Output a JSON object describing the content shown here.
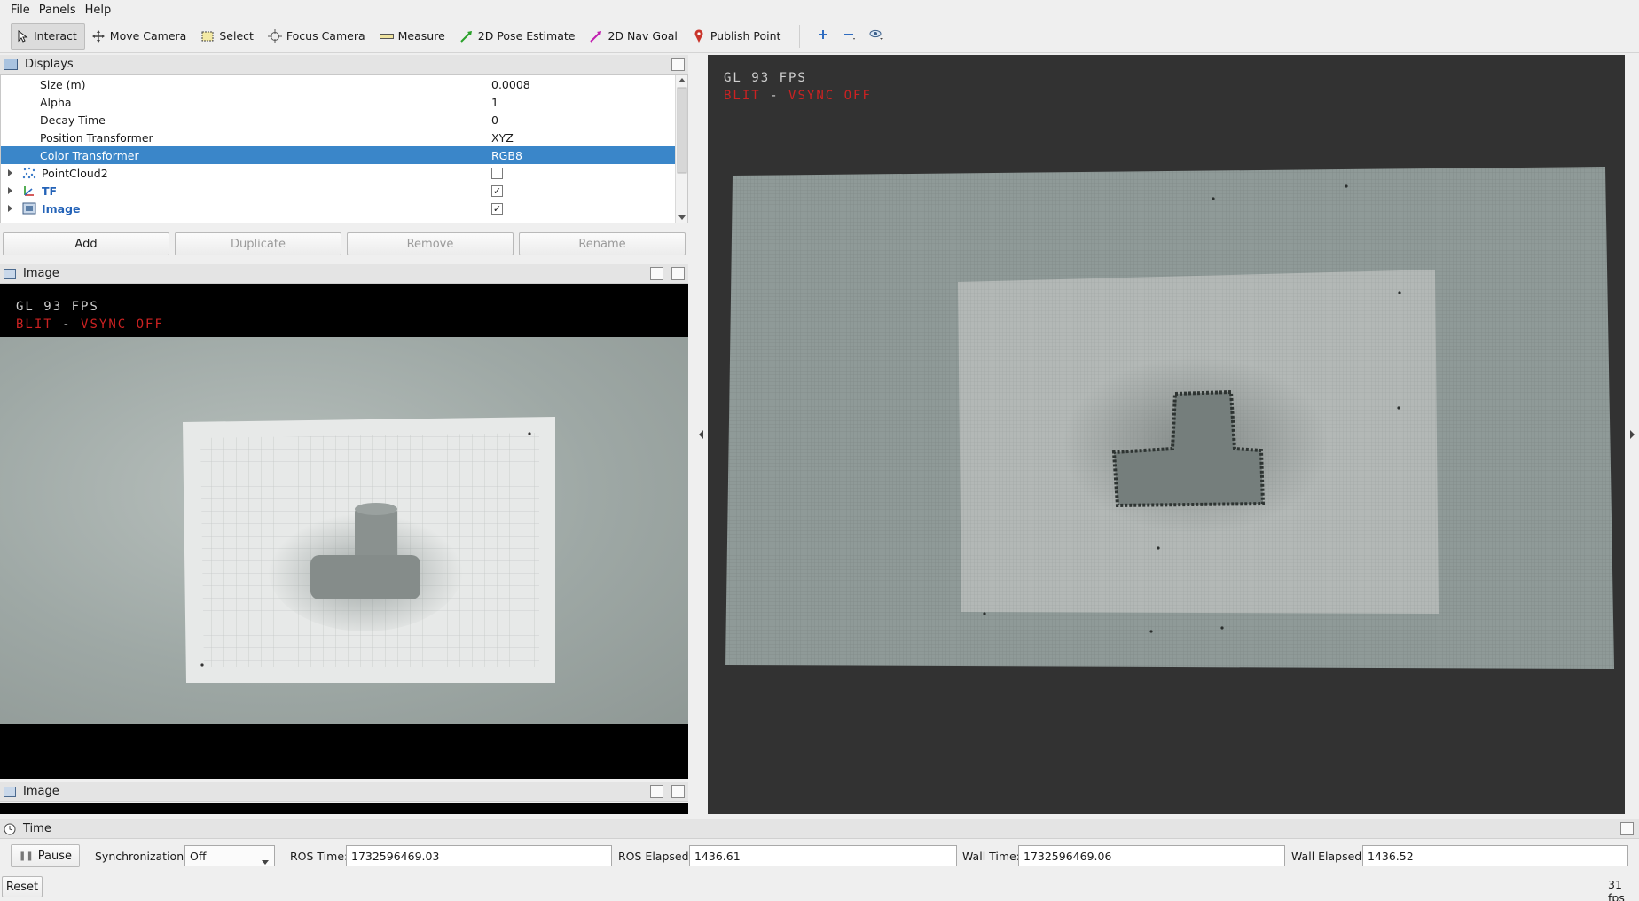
{
  "menu": {
    "file": "File",
    "panels": "Panels",
    "help": "Help"
  },
  "toolbar": {
    "interact": "Interact",
    "move_camera": "Move Camera",
    "select": "Select",
    "focus_camera": "Focus Camera",
    "measure": "Measure",
    "pose_estimate": "2D Pose Estimate",
    "nav_goal": "2D Nav Goal",
    "publish_point": "Publish Point"
  },
  "displays": {
    "title": "Displays",
    "props": [
      {
        "key": "Size (m)",
        "value": "0.0008"
      },
      {
        "key": "Alpha",
        "value": "1"
      },
      {
        "key": "Decay Time",
        "value": "0"
      },
      {
        "key": "Position Transformer",
        "value": "XYZ"
      },
      {
        "key": "Color Transformer",
        "value": "RGB8"
      }
    ],
    "items": [
      {
        "label": "PointCloud2",
        "checked": false
      },
      {
        "label": "TF",
        "checked": true
      },
      {
        "label": "Image",
        "checked": true
      }
    ],
    "buttons": {
      "add": "Add",
      "duplicate": "Duplicate",
      "remove": "Remove",
      "rename": "Rename"
    }
  },
  "image_panel_1": {
    "title": "Image"
  },
  "image_panel_2": {
    "title": "Image"
  },
  "overlay": {
    "fps": "GL 93 FPS",
    "blit": "BLIT",
    "dash": "-",
    "vsync": "VSYNC OFF"
  },
  "time": {
    "title": "Time",
    "pause": "Pause",
    "sync_label": "Synchronization:",
    "sync_value": "Off",
    "ros_time_label": "ROS Time:",
    "ros_time": "1732596469.03",
    "ros_elapsed_label": "ROS Elapsed:",
    "ros_elapsed": "1436.61",
    "wall_time_label": "Wall Time:",
    "wall_time": "1732596469.06",
    "wall_elapsed_label": "Wall Elapsed:",
    "wall_elapsed": "1436.52",
    "reset": "Reset",
    "fps": "31 fps"
  }
}
